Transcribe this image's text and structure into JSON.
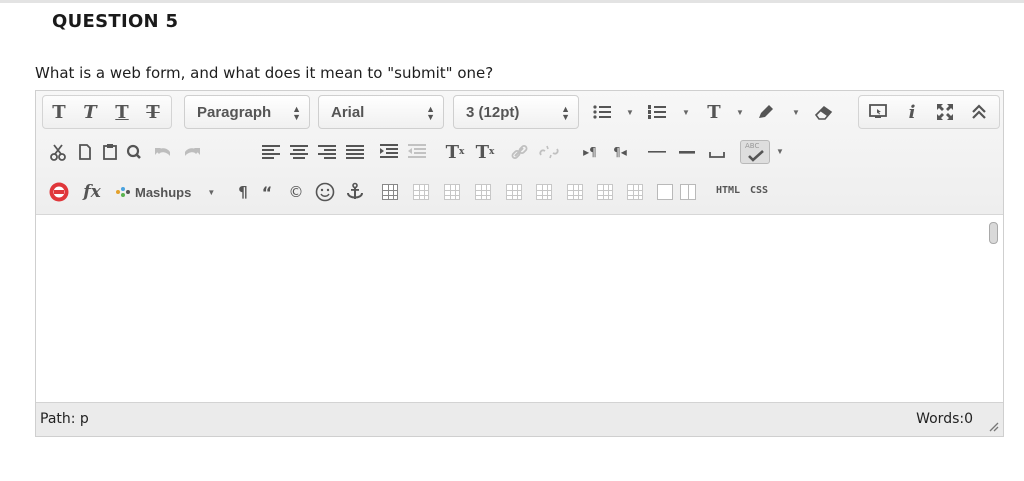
{
  "question": {
    "title": "QUESTION 5",
    "text": "What is a web form, and what does it mean to \"submit\" one?"
  },
  "toolbar": {
    "format_select": "Paragraph",
    "font_select": "Arial",
    "size_select": "3 (12pt)",
    "mashups_label": "Mashups",
    "html_label": "HTML",
    "css_label": "CSS",
    "bold_glyph": "T",
    "italic_glyph": "T",
    "underline_glyph": "T",
    "strike_glyph": "T",
    "superscript_glyph": "T",
    "subscript_glyph": "T",
    "text_color_glyph": "T",
    "spellcheck_badge": "ABC",
    "info_glyph": "i",
    "function_glyph": "fx"
  },
  "status": {
    "path_label": "Path: p",
    "words_label": "Words:0"
  },
  "colors": {
    "record_icon": "#e0373b",
    "toolbar_bg": "#eeeeee",
    "statusbar_bg": "#ebebeb"
  }
}
